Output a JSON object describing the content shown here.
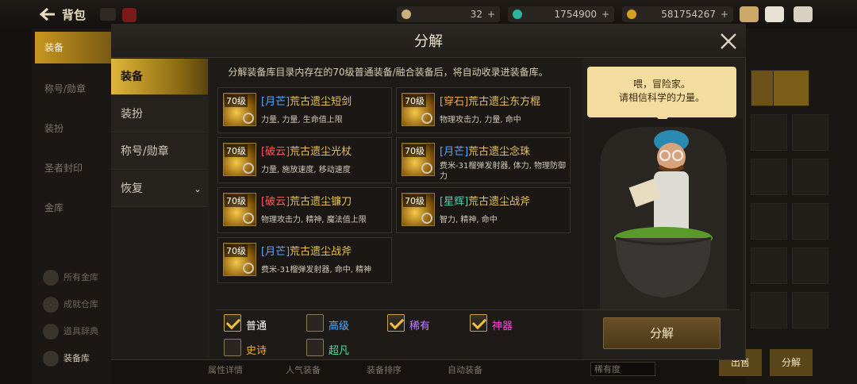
{
  "topbar": {
    "title": "背包",
    "currencies": [
      {
        "name": "coin-icon",
        "value": "32",
        "color": "#c9b27a"
      },
      {
        "name": "gem-icon",
        "value": "1754900",
        "color": "#2bb5a0"
      },
      {
        "name": "gold-icon",
        "value": "581754267",
        "color": "#d4a020"
      }
    ]
  },
  "bg_sidebar": {
    "items": [
      "装备",
      "称号/勋章",
      "装扮",
      "圣者封印",
      "金库"
    ],
    "subitems": [
      "所有金库",
      "成就仓库",
      "道具辞典",
      "装备库"
    ]
  },
  "modal": {
    "title": "分解",
    "tabs": [
      {
        "label": "装备",
        "active": true
      },
      {
        "label": "装扮",
        "active": false
      },
      {
        "label": "称号/勋章",
        "active": false
      },
      {
        "label": "恢复",
        "active": false
      }
    ],
    "info": "分解装备库目录内存在的70级普通装备/融合装备后，将自动收录进装备库。",
    "items": [
      {
        "level": "70级",
        "tag": "[月芒]",
        "tag_color": "#5aa7ff",
        "name": "荒古遗尘短剑",
        "stats": "力量, 力量, 生命值上限"
      },
      {
        "level": "70级",
        "tag": "[穿石]",
        "tag_color": "#e8a84a",
        "name": "荒古遗尘东方棍",
        "stats": "物理攻击力, 力量, 命中"
      },
      {
        "level": "70级",
        "tag": "[破云]",
        "tag_color": "#ff5a5a",
        "name": "荒古遗尘光杖",
        "stats": "力量, 施放速度, 移动速度"
      },
      {
        "level": "70级",
        "tag": "[月芒]",
        "tag_color": "#5aa7ff",
        "name": "荒古遗尘念珠",
        "stats": "费米-31榴弹发射器, 体力, 物理防御力"
      },
      {
        "level": "70级",
        "tag": "[破云]",
        "tag_color": "#ff5a5a",
        "name": "荒古遗尘镰刀",
        "stats": "物理攻击力, 精神, 魔法值上限"
      },
      {
        "level": "70级",
        "tag": "[星辉]",
        "tag_color": "#4ad6b0",
        "name": "荒古遗尘战斧",
        "stats": "智力, 精神, 命中"
      },
      {
        "level": "70级",
        "tag": "[月芒]",
        "tag_color": "#5aa7ff",
        "name": "荒古遗尘战斧",
        "stats": "费米-31榴弹发射器, 命中, 精神"
      }
    ],
    "filters": [
      {
        "label": "普通",
        "checked": true,
        "color": "#ffffff"
      },
      {
        "label": "高级",
        "checked": false,
        "color": "#4ab0ff"
      },
      {
        "label": "稀有",
        "checked": true,
        "color": "#c080ff"
      },
      {
        "label": "神器",
        "checked": true,
        "color": "#ff44dd"
      },
      {
        "label": "史诗",
        "checked": false,
        "color": "#ffb000"
      },
      {
        "label": "超凡",
        "checked": false,
        "color": "#4ae0a0"
      }
    ],
    "npc_speech": "喂，冒险家。\n请相信科学的力量。",
    "decompose_button": "分解"
  },
  "bg_bottom": {
    "buttons": [
      "属性详情",
      "人气装备",
      "装备排序",
      "自动装备"
    ],
    "sort_select": "稀有度",
    "sell_label": "出售",
    "decompose_label": "分解"
  }
}
